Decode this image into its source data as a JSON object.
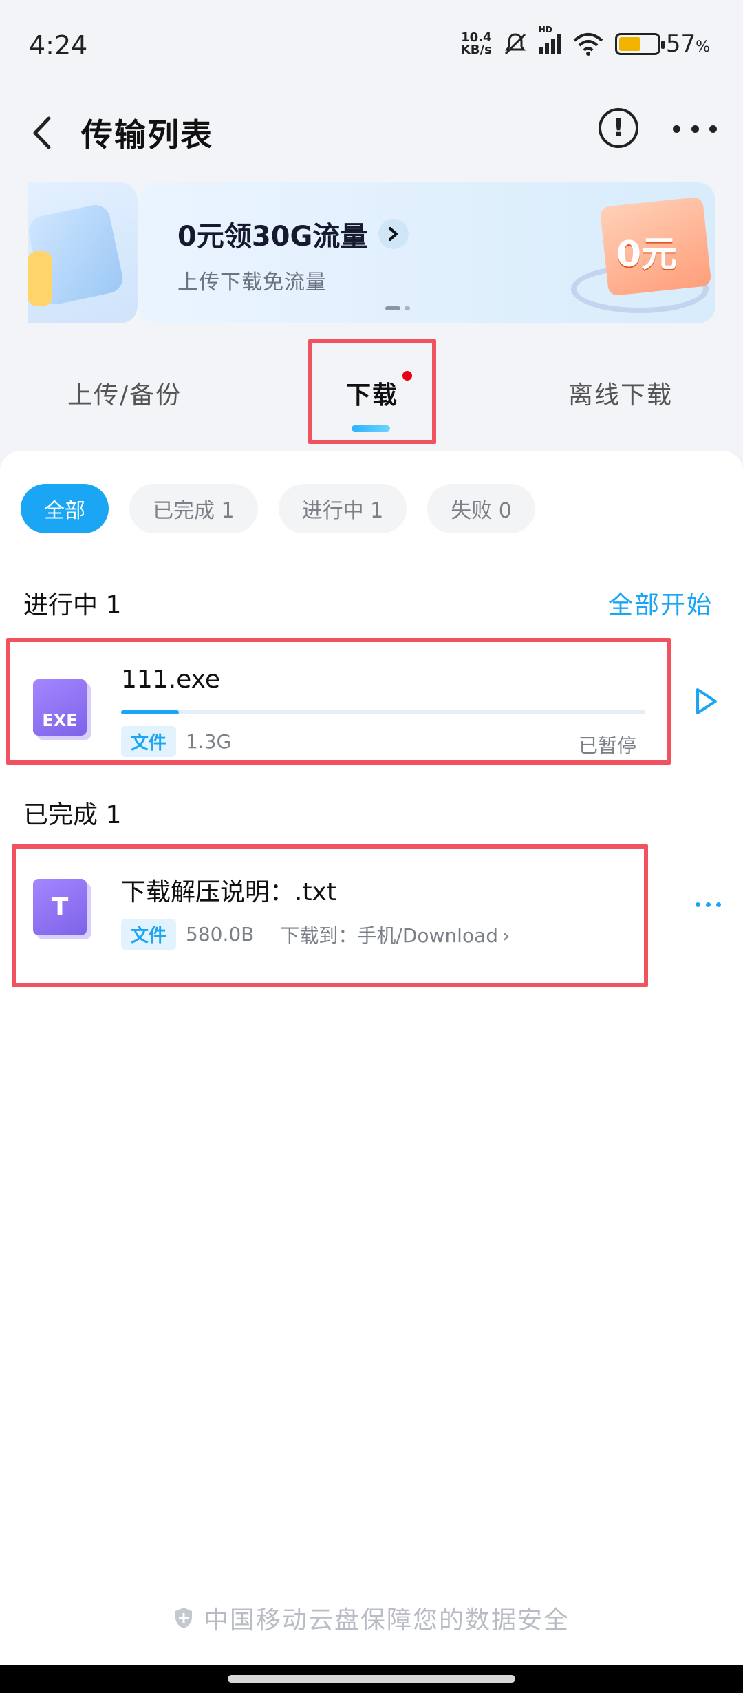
{
  "status_bar": {
    "time": "4:24",
    "net_speed_value": "10.4",
    "net_speed_unit": "KB/s",
    "signal_label": "HD",
    "battery_percent": "57",
    "battery_unit": "%",
    "battery_level": 0.57
  },
  "header": {
    "title": "传输列表"
  },
  "banner": {
    "title": "0元领30G流量",
    "subtitle": "上传下载免流量",
    "promo_text": "0元"
  },
  "tabs": [
    {
      "label": "上传/备份"
    },
    {
      "label": "下载"
    },
    {
      "label": "离线下载"
    }
  ],
  "filters": [
    {
      "label": "全部"
    },
    {
      "label": "已完成 1"
    },
    {
      "label": "进行中 1"
    },
    {
      "label": "失败 0"
    }
  ],
  "in_progress": {
    "title": "进行中 1",
    "action": "全部开始",
    "item": {
      "name": "111.exe",
      "icon_text": "EXE",
      "tag": "文件",
      "size": "1.3G",
      "status": "已暂停",
      "progress": 0.11
    }
  },
  "completed": {
    "title": "已完成 1",
    "item": {
      "name": "下载解压说明：.txt",
      "icon_text": "T",
      "tag": "文件",
      "size": "580.0B",
      "location_label": "下载到：",
      "location": "手机/Download",
      "chevron": "›"
    }
  },
  "footer": {
    "note": "中国移动云盘保障您的数据安全"
  },
  "colors": {
    "accent": "#1aa6f5",
    "highlight": "#f0535f",
    "badge_dot": "#e60012"
  }
}
